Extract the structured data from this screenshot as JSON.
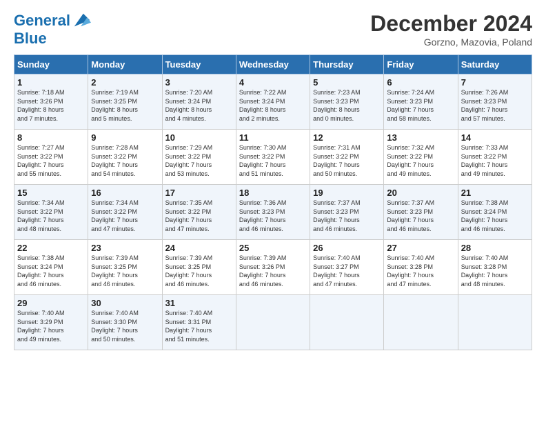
{
  "header": {
    "logo_line1": "General",
    "logo_line2": "Blue",
    "month": "December 2024",
    "location": "Gorzno, Mazovia, Poland"
  },
  "days_of_week": [
    "Sunday",
    "Monday",
    "Tuesday",
    "Wednesday",
    "Thursday",
    "Friday",
    "Saturday"
  ],
  "weeks": [
    [
      {
        "day": "1",
        "info": "Sunrise: 7:18 AM\nSunset: 3:26 PM\nDaylight: 8 hours\nand 7 minutes."
      },
      {
        "day": "2",
        "info": "Sunrise: 7:19 AM\nSunset: 3:25 PM\nDaylight: 8 hours\nand 5 minutes."
      },
      {
        "day": "3",
        "info": "Sunrise: 7:20 AM\nSunset: 3:24 PM\nDaylight: 8 hours\nand 4 minutes."
      },
      {
        "day": "4",
        "info": "Sunrise: 7:22 AM\nSunset: 3:24 PM\nDaylight: 8 hours\nand 2 minutes."
      },
      {
        "day": "5",
        "info": "Sunrise: 7:23 AM\nSunset: 3:23 PM\nDaylight: 8 hours\nand 0 minutes."
      },
      {
        "day": "6",
        "info": "Sunrise: 7:24 AM\nSunset: 3:23 PM\nDaylight: 7 hours\nand 58 minutes."
      },
      {
        "day": "7",
        "info": "Sunrise: 7:26 AM\nSunset: 3:23 PM\nDaylight: 7 hours\nand 57 minutes."
      }
    ],
    [
      {
        "day": "8",
        "info": "Sunrise: 7:27 AM\nSunset: 3:22 PM\nDaylight: 7 hours\nand 55 minutes."
      },
      {
        "day": "9",
        "info": "Sunrise: 7:28 AM\nSunset: 3:22 PM\nDaylight: 7 hours\nand 54 minutes."
      },
      {
        "day": "10",
        "info": "Sunrise: 7:29 AM\nSunset: 3:22 PM\nDaylight: 7 hours\nand 53 minutes."
      },
      {
        "day": "11",
        "info": "Sunrise: 7:30 AM\nSunset: 3:22 PM\nDaylight: 7 hours\nand 51 minutes."
      },
      {
        "day": "12",
        "info": "Sunrise: 7:31 AM\nSunset: 3:22 PM\nDaylight: 7 hours\nand 50 minutes."
      },
      {
        "day": "13",
        "info": "Sunrise: 7:32 AM\nSunset: 3:22 PM\nDaylight: 7 hours\nand 49 minutes."
      },
      {
        "day": "14",
        "info": "Sunrise: 7:33 AM\nSunset: 3:22 PM\nDaylight: 7 hours\nand 49 minutes."
      }
    ],
    [
      {
        "day": "15",
        "info": "Sunrise: 7:34 AM\nSunset: 3:22 PM\nDaylight: 7 hours\nand 48 minutes."
      },
      {
        "day": "16",
        "info": "Sunrise: 7:34 AM\nSunset: 3:22 PM\nDaylight: 7 hours\nand 47 minutes."
      },
      {
        "day": "17",
        "info": "Sunrise: 7:35 AM\nSunset: 3:22 PM\nDaylight: 7 hours\nand 47 minutes."
      },
      {
        "day": "18",
        "info": "Sunrise: 7:36 AM\nSunset: 3:23 PM\nDaylight: 7 hours\nand 46 minutes."
      },
      {
        "day": "19",
        "info": "Sunrise: 7:37 AM\nSunset: 3:23 PM\nDaylight: 7 hours\nand 46 minutes."
      },
      {
        "day": "20",
        "info": "Sunrise: 7:37 AM\nSunset: 3:23 PM\nDaylight: 7 hours\nand 46 minutes."
      },
      {
        "day": "21",
        "info": "Sunrise: 7:38 AM\nSunset: 3:24 PM\nDaylight: 7 hours\nand 46 minutes."
      }
    ],
    [
      {
        "day": "22",
        "info": "Sunrise: 7:38 AM\nSunset: 3:24 PM\nDaylight: 7 hours\nand 46 minutes."
      },
      {
        "day": "23",
        "info": "Sunrise: 7:39 AM\nSunset: 3:25 PM\nDaylight: 7 hours\nand 46 minutes."
      },
      {
        "day": "24",
        "info": "Sunrise: 7:39 AM\nSunset: 3:25 PM\nDaylight: 7 hours\nand 46 minutes."
      },
      {
        "day": "25",
        "info": "Sunrise: 7:39 AM\nSunset: 3:26 PM\nDaylight: 7 hours\nand 46 minutes."
      },
      {
        "day": "26",
        "info": "Sunrise: 7:40 AM\nSunset: 3:27 PM\nDaylight: 7 hours\nand 47 minutes."
      },
      {
        "day": "27",
        "info": "Sunrise: 7:40 AM\nSunset: 3:28 PM\nDaylight: 7 hours\nand 47 minutes."
      },
      {
        "day": "28",
        "info": "Sunrise: 7:40 AM\nSunset: 3:28 PM\nDaylight: 7 hours\nand 48 minutes."
      }
    ],
    [
      {
        "day": "29",
        "info": "Sunrise: 7:40 AM\nSunset: 3:29 PM\nDaylight: 7 hours\nand 49 minutes."
      },
      {
        "day": "30",
        "info": "Sunrise: 7:40 AM\nSunset: 3:30 PM\nDaylight: 7 hours\nand 50 minutes."
      },
      {
        "day": "31",
        "info": "Sunrise: 7:40 AM\nSunset: 3:31 PM\nDaylight: 7 hours\nand 51 minutes."
      },
      null,
      null,
      null,
      null
    ]
  ]
}
